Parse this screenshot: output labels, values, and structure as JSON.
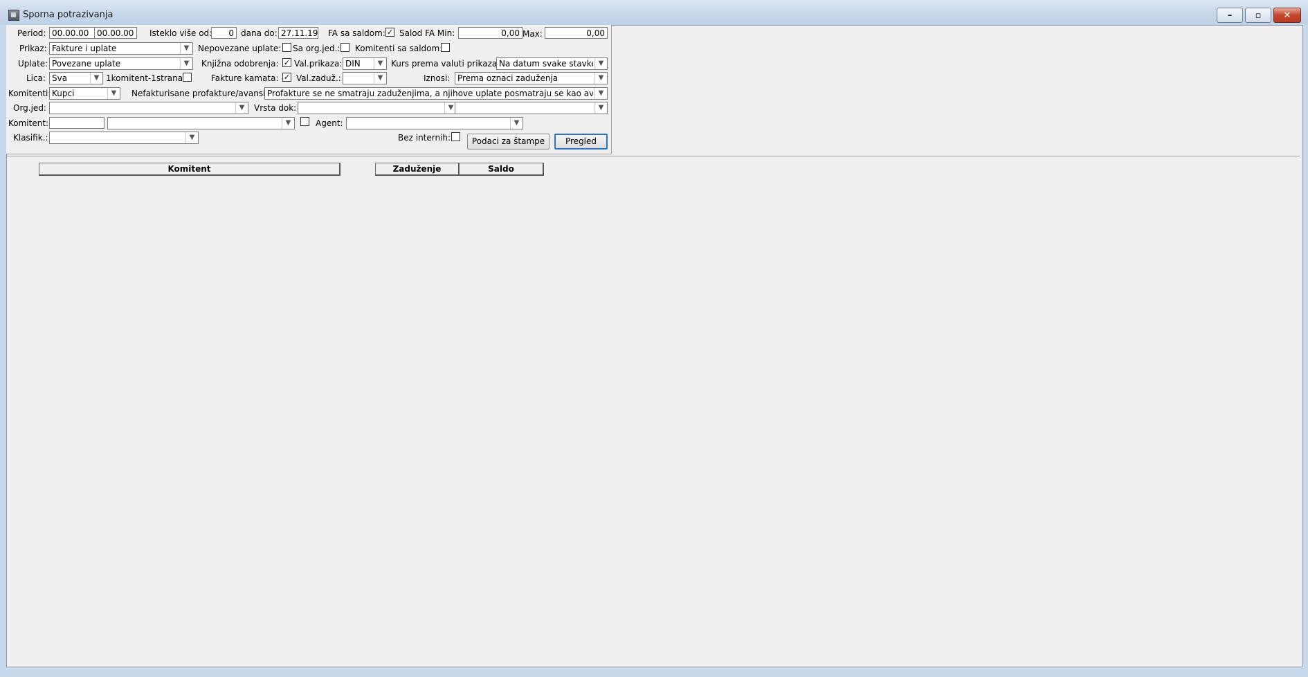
{
  "window": {
    "title": "Sporna potrazivanja",
    "minimize_label": "–",
    "restore_label": "▫",
    "close_label": "✕"
  },
  "filters": {
    "period_label": "Period:",
    "period_from": "00.00.00",
    "period_to": "00.00.00",
    "isteklo_label": "Isteklo više od:",
    "isteklo_value": "0",
    "dana_do_label": "dana do:",
    "dana_do_value": "27.11.19",
    "fa_sa_saldom_label": "FA sa saldom:",
    "fa_sa_saldom_checked": true,
    "salod_fa_min_label": "Salod FA Min:",
    "salod_fa_min_value": "0,00",
    "max_label": "Max:",
    "max_value": "0,00",
    "prikaz_label": "Prikaz:",
    "prikaz_value": "Fakture i uplate",
    "nepovezane_label": "Nepovezane uplate:",
    "nepovezane_checked": false,
    "sa_org_jed_label": "Sa org.jed.:",
    "sa_org_jed_checked": false,
    "komitenti_sa_saldom_label": "Komitenti sa saldom:",
    "komitenti_sa_saldom_checked": false,
    "uplate_label": "Uplate:",
    "uplate_value": "Povezane uplate",
    "knjizna_label": "Knjižna odobrenja:",
    "knjizna_checked": true,
    "val_prikaza_label": "Val.prikaza:",
    "val_prikaza_value": "DIN",
    "kurs_label": "Kurs prema valuti prikaza:",
    "kurs_value": "Na datum svake stavke",
    "lica_label": "Lica:",
    "lica_value": "Sva",
    "jedan_komitent_label": "1komitent-1strana:",
    "jedan_komitent_checked": false,
    "fakture_kamata_label": "Fakture kamata:",
    "fakture_kamata_checked": true,
    "val_zaduz_label": "Val.zaduž.:",
    "val_zaduz_value": "",
    "iznosi_label": "Iznosi:",
    "iznosi_value": "Prema oznaci zaduženja",
    "komitenti_label": "Komitenti:",
    "komitenti_value": "Kupci",
    "nefakturisane_label": "Nefakturisane profakture/avansi:",
    "nefakturisane_value": "Profakture se ne smatraju zaduženjima, a njihove uplate posmatraju se kao avansi",
    "org_jed_label": "Org.jed:",
    "org_jed_value": "",
    "vrsta_dok_label": "Vrsta dok:",
    "vrsta_dok_value": "",
    "vrsta_dok_value2": "",
    "komitent_label": "Komitent:",
    "komitent_code": "",
    "komitent_name": "",
    "komitent_checked": false,
    "agent_label": "Agent:",
    "agent_value": "",
    "klasifik_label": "Klasifik.:",
    "klasifik_value": "",
    "bez_internih_label": "Bez internih:",
    "bez_internih_checked": false,
    "podaci_button": "Podaci za štampe",
    "pregled_button": "Pregled"
  },
  "grid": {
    "columns": [
      "Komitent",
      "Zaduženje",
      "Saldo"
    ]
  },
  "icons": {
    "dropdown_arrow": "chevron-down-icon",
    "app_icon": "window-app-icon"
  },
  "colors": {
    "default_button_border": "#2b76c9",
    "close_button": "#c4452c"
  }
}
